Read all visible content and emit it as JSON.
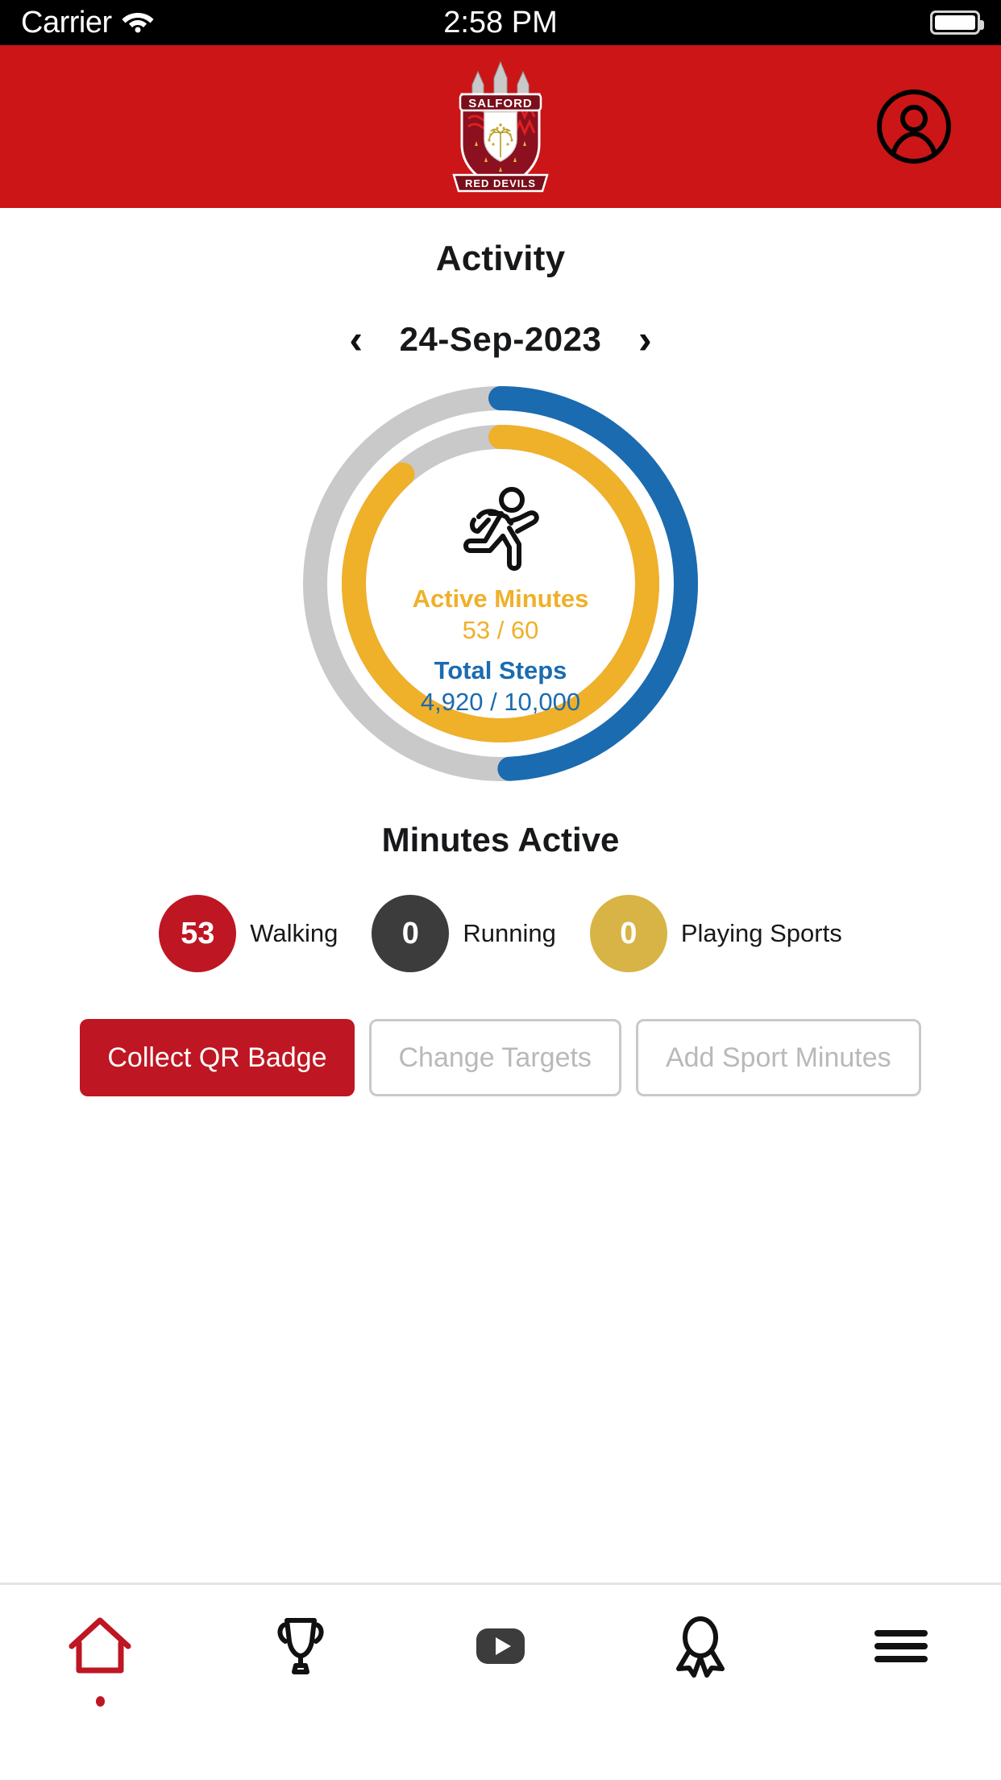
{
  "status_bar": {
    "carrier": "Carrier",
    "wifi_icon": "wifi-icon",
    "time": "2:58 PM",
    "battery_icon": "battery-full-icon"
  },
  "header": {
    "logo_name": "salford-red-devils-crest",
    "logo_top_text": "SALFORD",
    "logo_bottom_text": "RED DEVILS",
    "brand_color": "#CC1517",
    "avatar_icon": "account-circle-icon"
  },
  "main": {
    "page_title": "Activity",
    "date_nav": {
      "prev_icon": "chevron-left-icon",
      "date": "24-Sep-2023",
      "next_icon": "chevron-right-icon"
    },
    "rings": {
      "center_icon": "running-person-icon",
      "minutes_label": "Active Minutes",
      "minutes_value": "53 / 60",
      "steps_label": "Total Steps",
      "steps_value": "4,920 / 10,000",
      "minutes_color": "#EFB02A",
      "steps_color": "#1B6BB0",
      "track_color": "#C9C9C9"
    },
    "minutes_active": {
      "title": "Minutes Active",
      "stats": [
        {
          "value": "53",
          "label": "Walking",
          "color": "#BE1622"
        },
        {
          "value": "0",
          "label": "Running",
          "color": "#3C3C3C"
        },
        {
          "value": "0",
          "label": "Playing Sports",
          "color": "#D7B445"
        }
      ]
    },
    "buttons": [
      {
        "label": "Collect QR Badge",
        "style": "primary"
      },
      {
        "label": "Change Targets",
        "style": "ghost"
      },
      {
        "label": "Add Sport Minutes",
        "style": "ghost"
      }
    ]
  },
  "tabbar": {
    "items": [
      {
        "icon": "home-icon",
        "active": true
      },
      {
        "icon": "trophy-icon",
        "active": false
      },
      {
        "icon": "video-play-icon",
        "active": false
      },
      {
        "icon": "award-icon",
        "active": false
      },
      {
        "icon": "menu-icon",
        "active": false
      }
    ],
    "active_color": "#BE1622"
  },
  "chart_data": {
    "type": "pie",
    "title": "Activity Progress Rings",
    "series": [
      {
        "name": "Total Steps",
        "value": 4920,
        "target": 10000,
        "percent": 49.2,
        "color": "#1B6BB0",
        "ring": "outer"
      },
      {
        "name": "Active Minutes",
        "value": 53,
        "target": 60,
        "percent": 88.3,
        "color": "#EFB02A",
        "ring": "inner"
      }
    ],
    "breakdown": {
      "categories": [
        "Walking",
        "Running",
        "Playing Sports"
      ],
      "values": [
        53,
        0,
        0
      ],
      "colors": [
        "#BE1622",
        "#3C3C3C",
        "#D7B445"
      ],
      "ylabel": "Minutes Active"
    },
    "legend": "none",
    "grid": false
  }
}
